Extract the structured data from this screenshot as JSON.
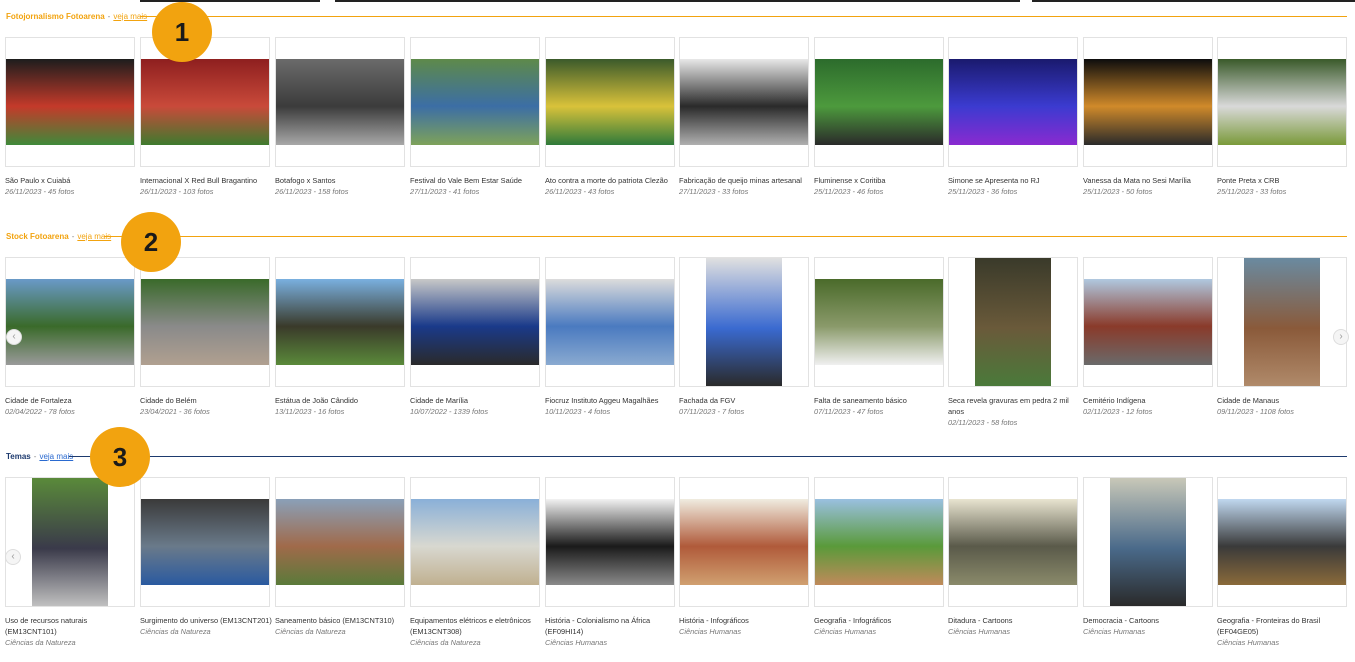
{
  "sections": [
    {
      "title": "Fotojornalismo Fotoarena",
      "separator": "-",
      "more_label": "veja mais",
      "badge": "1",
      "accent": "#f2a30f",
      "items": [
        {
          "title": "São Paulo x Cuiabá",
          "meta": "26/11/2023 - 45 fotos",
          "colors": [
            "#1d1d1d",
            "#c43a2a",
            "#3f8a3a"
          ]
        },
        {
          "title": "Internacional X Red Bull Bragantino",
          "meta": "26/11/2023 - 103 fotos",
          "colors": [
            "#8e1f1f",
            "#c94a3a",
            "#3e7a2e"
          ]
        },
        {
          "title": "Botafogo x Santos",
          "meta": "26/11/2023 - 158 fotos",
          "colors": [
            "#6b6b6b",
            "#3b3b3b",
            "#a8a8a8"
          ]
        },
        {
          "title": "Festival do Vale Bem Estar Saúde",
          "meta": "27/11/2023 - 41 fotos",
          "colors": [
            "#5e8a4a",
            "#3c6ea5",
            "#7ea25a"
          ]
        },
        {
          "title": "Ato contra a morte do patriota Clezão",
          "meta": "26/11/2023 - 43 fotos",
          "colors": [
            "#3b5a2b",
            "#d9c23a",
            "#2f7a3a"
          ]
        },
        {
          "title": "Fabricação de queijo minas artesanal",
          "meta": "27/11/2023 - 33 fotos",
          "colors": [
            "#e8e8e8",
            "#2a2a2a",
            "#b0b0b0"
          ]
        },
        {
          "title": "Fluminense x Coritiba",
          "meta": "25/11/2023 - 46 fotos",
          "colors": [
            "#2c6b2c",
            "#4d9a3d",
            "#2a2a2a"
          ]
        },
        {
          "title": "Simone se Apresenta no RJ",
          "meta": "25/11/2023 - 36 fotos",
          "colors": [
            "#1a1a6e",
            "#3b3bd0",
            "#8a2ad0"
          ]
        },
        {
          "title": "Vanessa da Mata no Sesi Marília",
          "meta": "25/11/2023 - 50 fotos",
          "colors": [
            "#0d0d0d",
            "#d08a2a",
            "#2a2a2a"
          ]
        },
        {
          "title": "Ponte Preta x CRB",
          "meta": "25/11/2023 - 33 fotos",
          "colors": [
            "#3a5a2a",
            "#d9d9d9",
            "#7a9a3a"
          ]
        }
      ]
    },
    {
      "title": "Stock Fotoarena",
      "separator": "-",
      "more_label": "veja mais",
      "badge": "2",
      "accent": "#f2a30f",
      "items": [
        {
          "title": "Cidade de Fortaleza",
          "meta": "02/04/2022 - 78 fotos",
          "colors": [
            "#6a9ac8",
            "#3a6a2a",
            "#9a9a9a"
          ]
        },
        {
          "title": "Cidade do Belém",
          "meta": "23/04/2021 - 36 fotos",
          "colors": [
            "#3a6a2a",
            "#8a8a8a",
            "#b0a090"
          ]
        },
        {
          "title": "Estátua de João Cândido",
          "meta": "13/11/2023 - 16 fotos",
          "colors": [
            "#7ab0e0",
            "#3a3a2a",
            "#5a8a3a"
          ]
        },
        {
          "title": "Cidade de Marília",
          "meta": "10/07/2022 - 1339 fotos",
          "colors": [
            "#c8c8c8",
            "#1a3a8a",
            "#2a2a2a"
          ]
        },
        {
          "title": "Fiocruz Instituto Aggeu Magalhães",
          "meta": "10/11/2023 - 4 fotos",
          "colors": [
            "#dcdcdc",
            "#4a7ac0",
            "#8aaad0"
          ]
        },
        {
          "title": "Fachada da FGV",
          "meta": "07/11/2023 - 7 fotos",
          "colors": [
            "#e0e0e0",
            "#3a6ad0",
            "#2a2a2a"
          ]
        },
        {
          "title": "Falta de saneamento básico",
          "meta": "07/11/2023 - 47 fotos",
          "colors": [
            "#4a6a2a",
            "#8a9a6a",
            "#f0f0f0"
          ]
        },
        {
          "title": "Seca revela gravuras em pedra 2 mil anos",
          "meta": "02/11/2023 - 58 fotos",
          "colors": [
            "#3a3a2a",
            "#6a5a3a",
            "#4a7a3a"
          ]
        },
        {
          "title": "Cemitério Indígena",
          "meta": "02/11/2023 - 12 fotos",
          "colors": [
            "#b0c8e0",
            "#8a3a2a",
            "#6a6a6a"
          ]
        },
        {
          "title": "Cidade de Manaus",
          "meta": "09/11/2023 - 1108 fotos",
          "colors": [
            "#6a8aa0",
            "#8a5a3a",
            "#b08a6a"
          ]
        }
      ]
    },
    {
      "title": "Temas",
      "separator": "-",
      "more_label": "veja mais",
      "badge": "3",
      "accent": "#1d3a6e",
      "items": [
        {
          "title": "Uso de recursos naturais (EM13CNT101)",
          "meta": "Ciências da Natureza",
          "colors": [
            "#5a8a3a",
            "#3a3a4a",
            "#c0c0c0"
          ]
        },
        {
          "title": "Surgimento do universo (EM13CNT201)",
          "meta": "Ciências da Natureza",
          "colors": [
            "#3a3a3a",
            "#6a7a8a",
            "#2a5aa0"
          ]
        },
        {
          "title": "Saneamento básico (EM13CNT310)",
          "meta": "Ciências da Natureza",
          "colors": [
            "#8aa0b8",
            "#a06a4a",
            "#5a7a3a"
          ]
        },
        {
          "title": "Equipamentos elétricos e eletrônicos (EM13CNT308)",
          "meta": "Ciências da Natureza",
          "colors": [
            "#8ab0d8",
            "#d8d8d0",
            "#c0b090"
          ]
        },
        {
          "title": "História - Colonialismo na África (EF09HI14)",
          "meta": "Ciências Humanas",
          "colors": [
            "#f2f2f2",
            "#1a1a1a",
            "#8a8a8a"
          ]
        },
        {
          "title": "História - Infográficos",
          "meta": "Ciências Humanas",
          "colors": [
            "#f0ece0",
            "#b05a3a",
            "#d0a070"
          ]
        },
        {
          "title": "Geografia - Infográficos",
          "meta": "Ciências Humanas",
          "colors": [
            "#9ac0e0",
            "#5a9a3a",
            "#c08a5a"
          ]
        },
        {
          "title": "Ditadura - Cartoons",
          "meta": "Ciências Humanas",
          "colors": [
            "#e8e4d0",
            "#5a5a4a",
            "#8a8a6a"
          ]
        },
        {
          "title": "Democracia - Cartoons",
          "meta": "Ciências Humanas",
          "colors": [
            "#c8c8b8",
            "#4a6a8a",
            "#2a2a2a"
          ]
        },
        {
          "title": "Geografia - Fronteiras do Brasil (EF04GE05)",
          "meta": "Ciências Humanas",
          "colors": [
            "#c0d8f0",
            "#3a3a3a",
            "#8a6a3a"
          ]
        }
      ]
    }
  ],
  "nav": {
    "next_icon": "›",
    "prev_icon": "‹"
  }
}
